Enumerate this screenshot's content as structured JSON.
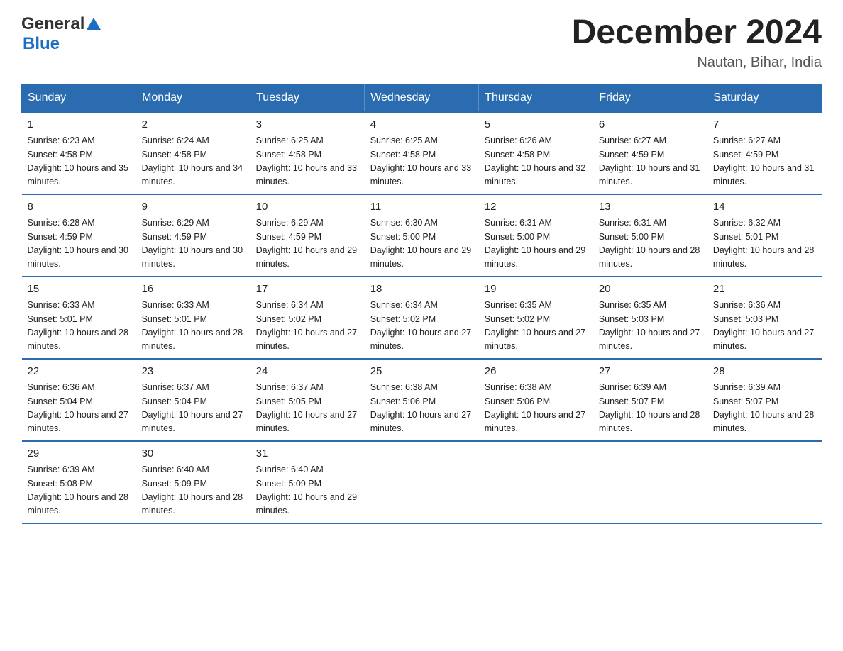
{
  "header": {
    "logo_general": "General",
    "logo_blue": "Blue",
    "month_title": "December 2024",
    "location": "Nautan, Bihar, India"
  },
  "columns": [
    "Sunday",
    "Monday",
    "Tuesday",
    "Wednesday",
    "Thursday",
    "Friday",
    "Saturday"
  ],
  "weeks": [
    [
      {
        "day": "1",
        "sunrise": "6:23 AM",
        "sunset": "4:58 PM",
        "daylight": "10 hours and 35 minutes."
      },
      {
        "day": "2",
        "sunrise": "6:24 AM",
        "sunset": "4:58 PM",
        "daylight": "10 hours and 34 minutes."
      },
      {
        "day": "3",
        "sunrise": "6:25 AM",
        "sunset": "4:58 PM",
        "daylight": "10 hours and 33 minutes."
      },
      {
        "day": "4",
        "sunrise": "6:25 AM",
        "sunset": "4:58 PM",
        "daylight": "10 hours and 33 minutes."
      },
      {
        "day": "5",
        "sunrise": "6:26 AM",
        "sunset": "4:58 PM",
        "daylight": "10 hours and 32 minutes."
      },
      {
        "day": "6",
        "sunrise": "6:27 AM",
        "sunset": "4:59 PM",
        "daylight": "10 hours and 31 minutes."
      },
      {
        "day": "7",
        "sunrise": "6:27 AM",
        "sunset": "4:59 PM",
        "daylight": "10 hours and 31 minutes."
      }
    ],
    [
      {
        "day": "8",
        "sunrise": "6:28 AM",
        "sunset": "4:59 PM",
        "daylight": "10 hours and 30 minutes."
      },
      {
        "day": "9",
        "sunrise": "6:29 AM",
        "sunset": "4:59 PM",
        "daylight": "10 hours and 30 minutes."
      },
      {
        "day": "10",
        "sunrise": "6:29 AM",
        "sunset": "4:59 PM",
        "daylight": "10 hours and 29 minutes."
      },
      {
        "day": "11",
        "sunrise": "6:30 AM",
        "sunset": "5:00 PM",
        "daylight": "10 hours and 29 minutes."
      },
      {
        "day": "12",
        "sunrise": "6:31 AM",
        "sunset": "5:00 PM",
        "daylight": "10 hours and 29 minutes."
      },
      {
        "day": "13",
        "sunrise": "6:31 AM",
        "sunset": "5:00 PM",
        "daylight": "10 hours and 28 minutes."
      },
      {
        "day": "14",
        "sunrise": "6:32 AM",
        "sunset": "5:01 PM",
        "daylight": "10 hours and 28 minutes."
      }
    ],
    [
      {
        "day": "15",
        "sunrise": "6:33 AM",
        "sunset": "5:01 PM",
        "daylight": "10 hours and 28 minutes."
      },
      {
        "day": "16",
        "sunrise": "6:33 AM",
        "sunset": "5:01 PM",
        "daylight": "10 hours and 28 minutes."
      },
      {
        "day": "17",
        "sunrise": "6:34 AM",
        "sunset": "5:02 PM",
        "daylight": "10 hours and 27 minutes."
      },
      {
        "day": "18",
        "sunrise": "6:34 AM",
        "sunset": "5:02 PM",
        "daylight": "10 hours and 27 minutes."
      },
      {
        "day": "19",
        "sunrise": "6:35 AM",
        "sunset": "5:02 PM",
        "daylight": "10 hours and 27 minutes."
      },
      {
        "day": "20",
        "sunrise": "6:35 AM",
        "sunset": "5:03 PM",
        "daylight": "10 hours and 27 minutes."
      },
      {
        "day": "21",
        "sunrise": "6:36 AM",
        "sunset": "5:03 PM",
        "daylight": "10 hours and 27 minutes."
      }
    ],
    [
      {
        "day": "22",
        "sunrise": "6:36 AM",
        "sunset": "5:04 PM",
        "daylight": "10 hours and 27 minutes."
      },
      {
        "day": "23",
        "sunrise": "6:37 AM",
        "sunset": "5:04 PM",
        "daylight": "10 hours and 27 minutes."
      },
      {
        "day": "24",
        "sunrise": "6:37 AM",
        "sunset": "5:05 PM",
        "daylight": "10 hours and 27 minutes."
      },
      {
        "day": "25",
        "sunrise": "6:38 AM",
        "sunset": "5:06 PM",
        "daylight": "10 hours and 27 minutes."
      },
      {
        "day": "26",
        "sunrise": "6:38 AM",
        "sunset": "5:06 PM",
        "daylight": "10 hours and 27 minutes."
      },
      {
        "day": "27",
        "sunrise": "6:39 AM",
        "sunset": "5:07 PM",
        "daylight": "10 hours and 28 minutes."
      },
      {
        "day": "28",
        "sunrise": "6:39 AM",
        "sunset": "5:07 PM",
        "daylight": "10 hours and 28 minutes."
      }
    ],
    [
      {
        "day": "29",
        "sunrise": "6:39 AM",
        "sunset": "5:08 PM",
        "daylight": "10 hours and 28 minutes."
      },
      {
        "day": "30",
        "sunrise": "6:40 AM",
        "sunset": "5:09 PM",
        "daylight": "10 hours and 28 minutes."
      },
      {
        "day": "31",
        "sunrise": "6:40 AM",
        "sunset": "5:09 PM",
        "daylight": "10 hours and 29 minutes."
      },
      {
        "day": "",
        "sunrise": "",
        "sunset": "",
        "daylight": ""
      },
      {
        "day": "",
        "sunrise": "",
        "sunset": "",
        "daylight": ""
      },
      {
        "day": "",
        "sunrise": "",
        "sunset": "",
        "daylight": ""
      },
      {
        "day": "",
        "sunrise": "",
        "sunset": "",
        "daylight": ""
      }
    ]
  ],
  "labels": {
    "sunrise_prefix": "Sunrise: ",
    "sunset_prefix": "Sunset: ",
    "daylight_prefix": "Daylight: "
  }
}
